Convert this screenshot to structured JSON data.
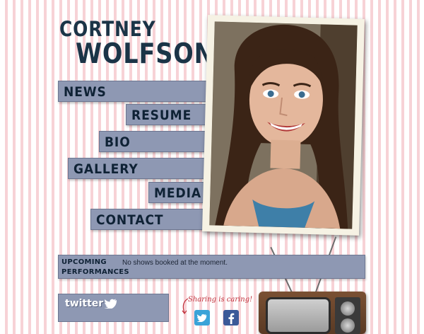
{
  "header": {
    "name_line1": "CORTNEY",
    "name_line2": "WOLFSON"
  },
  "nav": {
    "items": [
      {
        "label": "NEWS"
      },
      {
        "label": "RESUME"
      },
      {
        "label": "BIO"
      },
      {
        "label": "GALLERY"
      },
      {
        "label": "MEDIA"
      },
      {
        "label": "CONTACT"
      }
    ]
  },
  "shows": {
    "title_line1": "UPCOMING",
    "title_line2": "PERFORMANCES",
    "text": "No shows booked at the moment."
  },
  "twitter": {
    "logo_text": "twitter"
  },
  "sharing": {
    "text": "Sharing is caring!",
    "icons": [
      "twitter-icon",
      "facebook-icon"
    ]
  },
  "colors": {
    "nav_bg": "#8e98b3",
    "logo_text": "#1b3447",
    "stripe_pink": "#f7d2d6",
    "sharing_red": "#c0323c",
    "twitter_blue": "#3aa3d8",
    "facebook_blue": "#3b5998"
  }
}
